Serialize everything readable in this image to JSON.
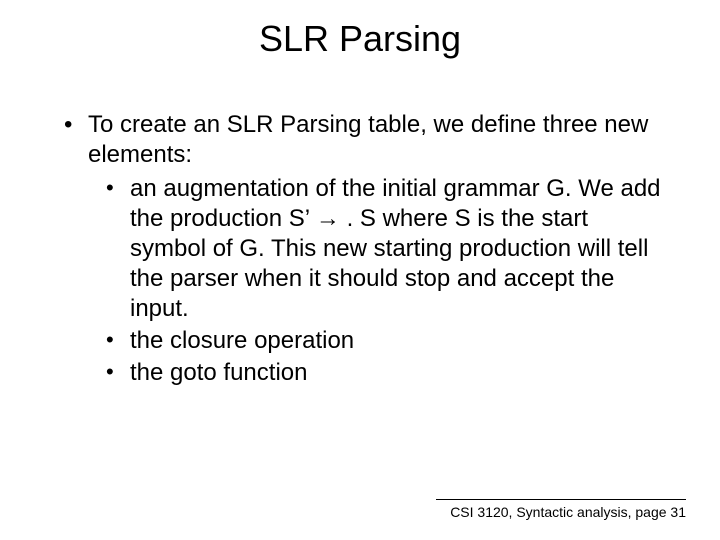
{
  "title": "SLR Parsing",
  "bullets": {
    "l1_0": "To create an SLR Parsing table, we define three new elements:",
    "l2_0": "an augmentation of the initial grammar G. We add the production S’ → . S where S is the start symbol of G. This new starting production will tell the parser when it should stop and accept the input.",
    "l2_1": "the closure operation",
    "l2_2": "the goto function"
  },
  "footer": "CSI 3120, Syntactic analysis, page 31"
}
